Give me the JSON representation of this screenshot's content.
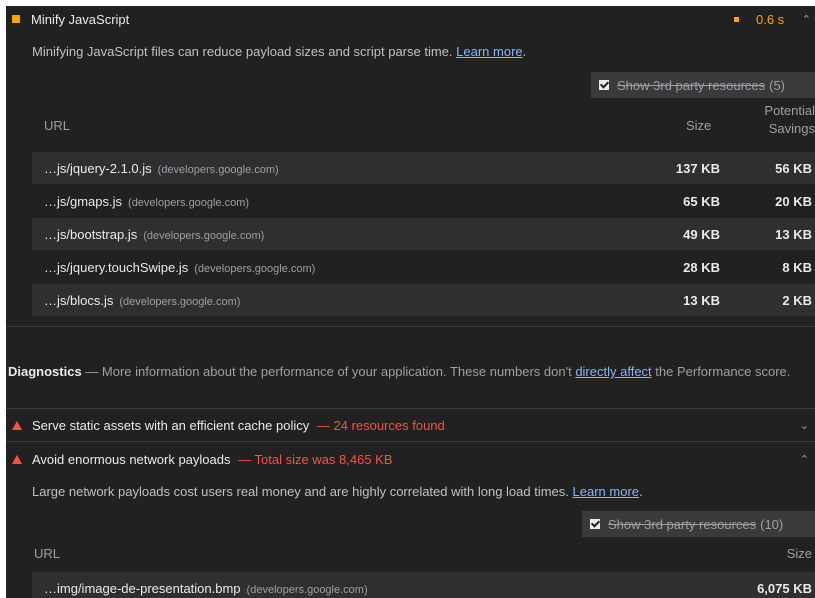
{
  "minify_js": {
    "title": "Minify JavaScript",
    "savings_time": "0.6 s",
    "description": "Minifying JavaScript files can reduce payload sizes and script parse time.",
    "learn_more": "Learn more",
    "third_party_label": "Show 3rd party resources",
    "third_party_count": "(5)",
    "columns": {
      "url": "URL",
      "size": "Size",
      "savings_line1": "Potential",
      "savings_line2": "Savings"
    },
    "rows": [
      {
        "url": "…js/jquery-2.1.0.js",
        "host": "(developers.google.com)",
        "size": "137 KB",
        "savings": "56 KB"
      },
      {
        "url": "…js/gmaps.js",
        "host": "(developers.google.com)",
        "size": "65 KB",
        "savings": "20 KB"
      },
      {
        "url": "…js/bootstrap.js",
        "host": "(developers.google.com)",
        "size": "49 KB",
        "savings": "13 KB"
      },
      {
        "url": "…js/jquery.touchSwipe.js",
        "host": "(developers.google.com)",
        "size": "28 KB",
        "savings": "8 KB"
      },
      {
        "url": "…js/blocs.js",
        "host": "(developers.google.com)",
        "size": "13 KB",
        "savings": "2 KB"
      }
    ]
  },
  "diagnostics": {
    "heading": "Diagnostics",
    "text_before": " — More information about the performance of your application. These numbers don't ",
    "link": "directly affect",
    "text_after": " the Performance score."
  },
  "cache_policy": {
    "title": "Serve static assets with an efficient cache policy",
    "detail": "— 24 resources found"
  },
  "payloads": {
    "title": "Avoid enormous network payloads",
    "detail": "— Total size was 8,465 KB",
    "description": "Large network payloads cost users real money and are highly correlated with long load times.",
    "learn_more": "Learn more",
    "third_party_label": "Show 3rd party resources",
    "third_party_count": "(10)",
    "columns": {
      "url": "URL",
      "size": "Size"
    },
    "rows": [
      {
        "url": "…img/image-de-presentation.bmp",
        "host": "(developers.google.com)",
        "size": "6,075 KB"
      }
    ]
  },
  "icons": {
    "collapse": "chevron-up-icon",
    "expand": "chevron-down-icon",
    "average": "orange-square-icon",
    "fail": "red-triangle-icon",
    "checkbox": "checkbox-checked-icon"
  }
}
